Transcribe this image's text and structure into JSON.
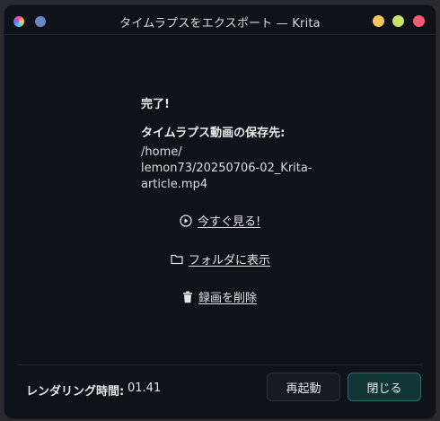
{
  "window": {
    "title": "タイムラプスをエクスポート — Krita"
  },
  "status": {
    "done": "完了!",
    "saved_label": "タイムラプス動画の保存先:",
    "saved_path": "/home/\nlemon73/20250706-02_Krita-\narticle.mp4"
  },
  "actions": {
    "watch_now": "今すぐ見る!",
    "show_in_folder": "フォルダに表示",
    "delete_recording": "録画を削除"
  },
  "footer": {
    "render_time_label": "レンダリング時間:",
    "render_time_value": "01.41",
    "restart_button": "再起動",
    "close_button": "閉じる"
  },
  "icons": {
    "app": "krita-app-icon",
    "play": "play-circle-icon",
    "folder": "folder-icon",
    "trash": "trash-icon"
  },
  "colors": {
    "window_bg": "#0f1218",
    "minimize": "#f4c55a",
    "maximize": "#c8e36a",
    "close": "#f05a73",
    "primary_button_bg": "#103636",
    "primary_button_border": "#2c6a66"
  }
}
